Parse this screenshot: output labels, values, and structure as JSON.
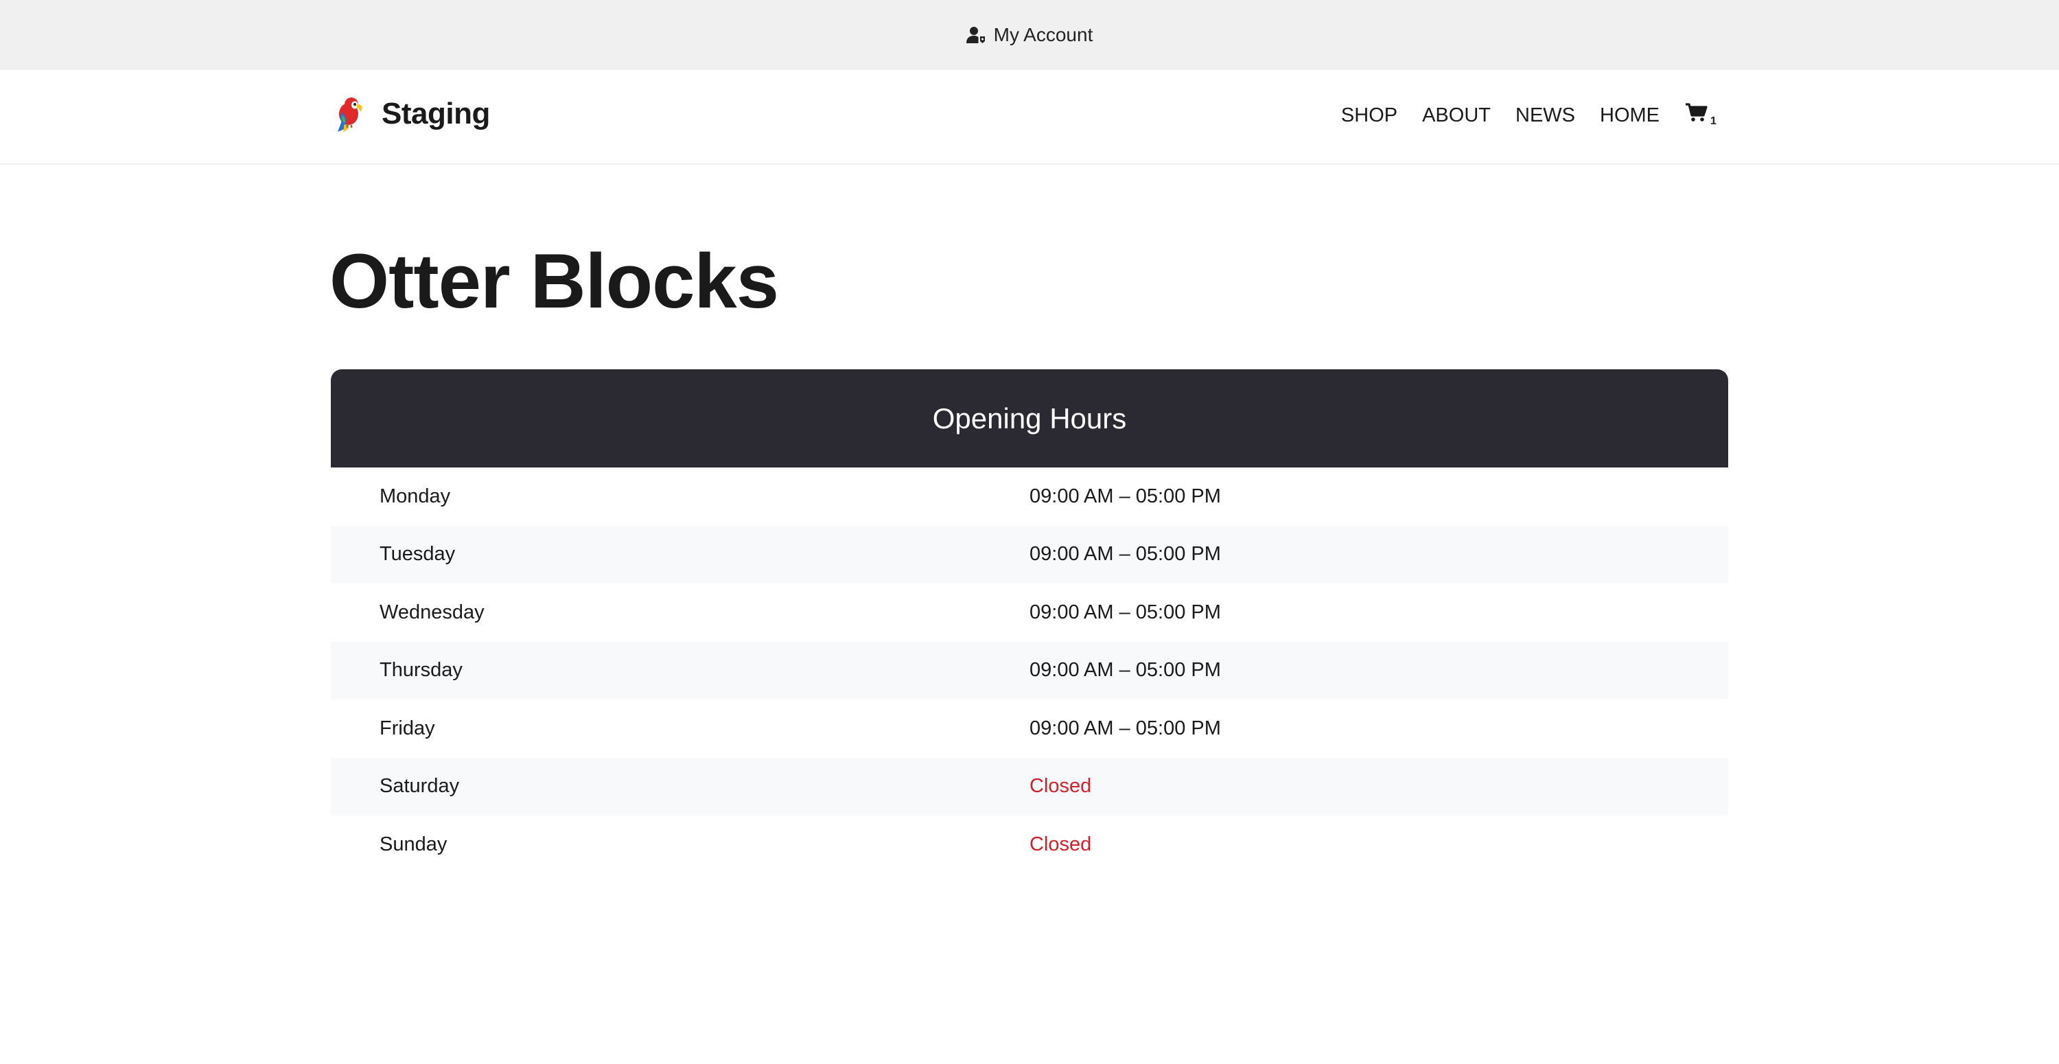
{
  "topbar": {
    "account_label": "My Account",
    "account_icon": "user-account-icon"
  },
  "header": {
    "site_name": "Staging",
    "logo_icon": "parrot-logo-icon",
    "nav": [
      {
        "label": "SHOP"
      },
      {
        "label": "ABOUT"
      },
      {
        "label": "NEWS"
      },
      {
        "label": "HOME"
      }
    ],
    "cart_icon": "cart-icon",
    "cart_count": "1"
  },
  "page": {
    "title": "Otter Blocks"
  },
  "opening_hours": {
    "title": "Opening Hours",
    "closed_color": "#d0202a",
    "header_color": "#2b2a33",
    "rows": [
      {
        "day": "Monday",
        "time": "09:00 AM – 05:00 PM",
        "closed": false
      },
      {
        "day": "Tuesday",
        "time": "09:00 AM – 05:00 PM",
        "closed": false
      },
      {
        "day": "Wednesday",
        "time": "09:00 AM – 05:00 PM",
        "closed": false
      },
      {
        "day": "Thursday",
        "time": "09:00 AM – 05:00 PM",
        "closed": false
      },
      {
        "day": "Friday",
        "time": "09:00 AM – 05:00 PM",
        "closed": false
      },
      {
        "day": "Saturday",
        "time": "Closed",
        "closed": true
      },
      {
        "day": "Sunday",
        "time": "Closed",
        "closed": true
      }
    ]
  }
}
